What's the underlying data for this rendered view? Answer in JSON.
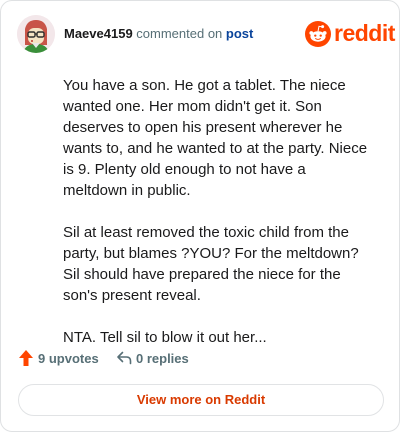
{
  "header": {
    "username": "Maeve4159",
    "action_text": "commented on",
    "post_link": "post"
  },
  "brand": {
    "name": "reddit",
    "icon": "reddit-snoo-icon",
    "color": "#ff4500"
  },
  "comment": {
    "paragraphs": [
      "You have a son. He got a tablet. The niece wanted one. Her mom didn't get it. Son deserves to open his present wherever he wants to, and he wanted to at the party. Niece is 9. Plenty old enough to not have a meltdown in public.",
      "Sil at least removed the toxic child from the party, but blames ?YOU? For the meltdown? Sil should have prepared the niece for the son's present reveal.",
      "NTA. Tell sil to blow it out her..."
    ]
  },
  "actions": {
    "upvotes_label": "9 upvotes",
    "replies_label": "0 replies",
    "upvote_color": "#ff4500"
  },
  "footer": {
    "view_more_label": "View more on Reddit"
  }
}
